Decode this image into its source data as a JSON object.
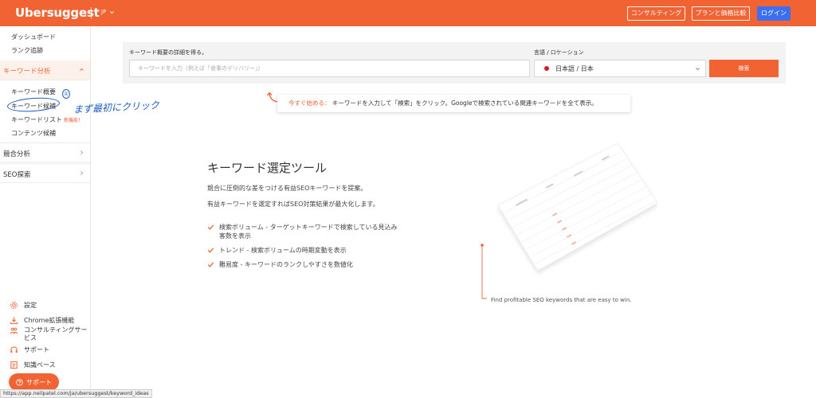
{
  "header": {
    "logo": "Ubersuggest",
    "lang": "JP",
    "consulting_label": "コンサルティング",
    "plans_label": "プランと価格比較",
    "login_label": "ログイン"
  },
  "sidebar": {
    "top_links": [
      "ダッシュボード",
      "ランク追跡"
    ],
    "keyword_section": "キーワード分析",
    "keyword_items": [
      "キーワード概要",
      "キーワード候補",
      "キーワードリスト",
      "コンテンツ候補"
    ],
    "new_badge": "新機能！",
    "competition_section": "競合分析",
    "seo_section": "SEO探索",
    "bottom_links": [
      "設定",
      "Chrome拡張機能",
      "コンサルティングサービス",
      "サポート",
      "知識ベース"
    ],
    "support_button": "サポート"
  },
  "annotation": {
    "number": "①",
    "text": "まず最初にクリック"
  },
  "search": {
    "keyword_label": "キーワード概要の詳細を得る。",
    "keyword_placeholder": "キーワードを入力（例えば「食事のデリバリー」）",
    "location_label": "言語 / ロケーション",
    "location_value": "日本語 / 日本",
    "search_button": "検索"
  },
  "hint": {
    "prefix": "今すぐ始める：",
    "text": "キーワードを入力して「検索」をクリック。Googleで検索されている関連キーワードを全て表示。"
  },
  "main": {
    "title": "キーワード選定ツール",
    "desc1": "競合に圧倒的な差をつける有益SEOキーワードを提案。",
    "desc2": "有益キーワードを選定すればSEO対策結果が最大化します。",
    "features": [
      "検索ボリューム - ターゲットキーワードで検索している見込み客数を表示",
      "トレンド - 検索ボリュームの時期変動を表示",
      "難易度 - キーワードのランクしやすさを数値化"
    ],
    "illustration_caption": "Find profitable SEO keywords that are easy to win."
  },
  "statusbar": {
    "url": "https://app.neilpatel.com/ja/ubersuggest/keyword_ideas"
  },
  "colors": {
    "brand": "#f26334",
    "login": "#3b6ff0",
    "annotation": "#1e5bbf"
  }
}
